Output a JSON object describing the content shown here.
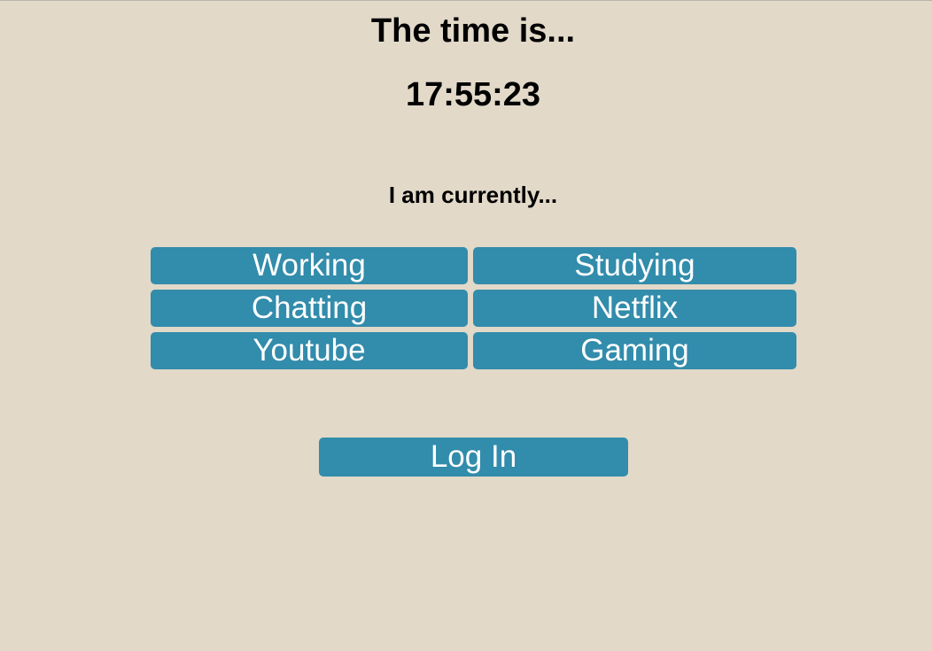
{
  "header": {
    "title": "The time is...",
    "clock": "17:55:23",
    "prompt": "I am currently..."
  },
  "activities": [
    {
      "label": "Working"
    },
    {
      "label": "Studying"
    },
    {
      "label": "Chatting"
    },
    {
      "label": "Netflix"
    },
    {
      "label": "Youtube"
    },
    {
      "label": "Gaming"
    }
  ],
  "login": {
    "label": "Log In"
  },
  "colors": {
    "background": "#e2d9c9",
    "button": "#328cab",
    "button_text": "#ffffff"
  }
}
